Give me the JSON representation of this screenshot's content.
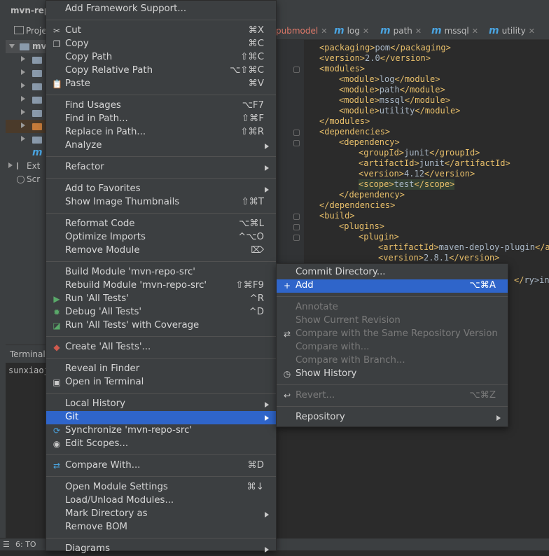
{
  "window": {
    "title": "mvn-repo"
  },
  "project_panel": {
    "label": "Proje",
    "root": "mv",
    "ext": "Ext",
    "scr": "Scr"
  },
  "terminal": {
    "label": "Terminal",
    "prompt": "sunxiaoj"
  },
  "bottom_bar": {
    "label": "6: TO"
  },
  "tabs": [
    {
      "label": "pubmodel",
      "active": true
    },
    {
      "label": "log"
    },
    {
      "label": "path"
    },
    {
      "label": "mssql"
    },
    {
      "label": "utility"
    }
  ],
  "code_lines": [
    {
      "indent": 0,
      "open": "<packaging>",
      "text": "pom",
      "close": "</packaging>"
    },
    {
      "indent": 0,
      "open": "<version>",
      "text": "2.0",
      "close": "</version>"
    },
    {
      "indent": 0,
      "open": "<modules>",
      "text": "",
      "close": ""
    },
    {
      "indent": 1,
      "open": "<module>",
      "text": "log",
      "close": "</module>"
    },
    {
      "indent": 1,
      "open": "<module>",
      "text": "path",
      "close": "</module>"
    },
    {
      "indent": 1,
      "open": "<module>",
      "text": "mssql",
      "close": "</module>"
    },
    {
      "indent": 1,
      "open": "<module>",
      "text": "utility",
      "close": "</module>"
    },
    {
      "indent": 0,
      "open": "</modules>",
      "text": "",
      "close": ""
    },
    {
      "indent": 0,
      "open": "<dependencies>",
      "text": "",
      "close": ""
    },
    {
      "indent": 1,
      "open": "<dependency>",
      "text": "",
      "close": ""
    },
    {
      "indent": 2,
      "open": "<groupId>",
      "text": "junit",
      "close": "</groupId>"
    },
    {
      "indent": 2,
      "open": "<artifactId>",
      "text": "junit",
      "close": "</artifactId>"
    },
    {
      "indent": 2,
      "open": "<version>",
      "text": "4.12",
      "close": "</version>"
    },
    {
      "indent": 2,
      "open": "<scope>",
      "text": "test",
      "close": "</scope>",
      "highlight": true
    },
    {
      "indent": 1,
      "open": "</dependency>",
      "text": "",
      "close": ""
    },
    {
      "indent": 0,
      "open": "</dependencies>",
      "text": "",
      "close": ""
    },
    {
      "indent": 0,
      "open": "<build>",
      "text": "",
      "close": ""
    },
    {
      "indent": 1,
      "open": "<plugins>",
      "text": "",
      "close": ""
    },
    {
      "indent": 2,
      "open": "<plugin>",
      "text": "",
      "close": ""
    },
    {
      "indent": 3,
      "open": "<artifactId>",
      "text": "maven-deploy-plugin",
      "close": "</ar"
    },
    {
      "indent": 3,
      "open": "<version>",
      "text": "2.8.1",
      "close": "</version>"
    }
  ],
  "code_fragment": "ry>intern",
  "context_menu": {
    "sections": [
      [
        {
          "label": "Add Framework Support..."
        }
      ],
      [
        {
          "label": "Cut",
          "shortcut": "⌘X",
          "icon": "cut-icon",
          "glyph": "✂"
        },
        {
          "label": "Copy",
          "shortcut": "⌘C",
          "icon": "copy-icon",
          "glyph": "❐"
        },
        {
          "label": "Copy Path",
          "shortcut": "⇧⌘C"
        },
        {
          "label": "Copy Relative Path",
          "shortcut": "⌥⇧⌘C"
        },
        {
          "label": "Paste",
          "shortcut": "⌘V",
          "icon": "paste-icon",
          "glyph": "📋"
        }
      ],
      [
        {
          "label": "Find Usages",
          "shortcut": "⌥F7"
        },
        {
          "label": "Find in Path...",
          "shortcut": "⇧⌘F"
        },
        {
          "label": "Replace in Path...",
          "shortcut": "⇧⌘R"
        },
        {
          "label": "Analyze",
          "submenu": true
        }
      ],
      [
        {
          "label": "Refactor",
          "submenu": true
        }
      ],
      [
        {
          "label": "Add to Favorites",
          "submenu": true
        },
        {
          "label": "Show Image Thumbnails",
          "shortcut": "⇧⌘T"
        }
      ],
      [
        {
          "label": "Reformat Code",
          "shortcut": "⌥⌘L"
        },
        {
          "label": "Optimize Imports",
          "shortcut": "^⌥O"
        },
        {
          "label": "Remove Module",
          "shortcut": "⌦"
        }
      ],
      [
        {
          "label": "Build Module 'mvn-repo-src'"
        },
        {
          "label": "Rebuild Module 'mvn-repo-src'",
          "shortcut": "⇧⌘F9"
        },
        {
          "label": "Run 'All Tests'",
          "shortcut": "^R",
          "icon": "run-icon",
          "glyph": "▶",
          "color": "#59a869"
        },
        {
          "label": "Debug 'All Tests'",
          "shortcut": "^D",
          "icon": "debug-icon",
          "glyph": "✹",
          "color": "#59a869"
        },
        {
          "label": "Run 'All Tests' with Coverage",
          "icon": "coverage-icon",
          "glyph": "◪",
          "color": "#59a869"
        }
      ],
      [
        {
          "label": "Create 'All Tests'...",
          "icon": "create-test-icon",
          "glyph": "◆",
          "color": "#d05a4e"
        }
      ],
      [
        {
          "label": "Reveal in Finder"
        },
        {
          "label": "Open in Terminal",
          "icon": "terminal-icon",
          "glyph": "▣"
        }
      ],
      [
        {
          "label": "Local History",
          "submenu": true
        },
        {
          "label": "Git",
          "submenu": true,
          "highlighted": true
        },
        {
          "label": "Synchronize 'mvn-repo-src'",
          "icon": "sync-icon",
          "glyph": "⟳",
          "color": "#4aa4e0"
        },
        {
          "label": "Edit Scopes...",
          "icon": "scopes-icon",
          "glyph": "◉"
        }
      ],
      [
        {
          "label": "Compare With...",
          "shortcut": "⌘D",
          "icon": "compare-icon",
          "glyph": "⇄",
          "color": "#4aa4e0"
        }
      ],
      [
        {
          "label": "Open Module Settings",
          "shortcut": "⌘↓"
        },
        {
          "label": "Load/Unload Modules..."
        },
        {
          "label": "Mark Directory as",
          "submenu": true
        },
        {
          "label": "Remove BOM"
        }
      ],
      [
        {
          "label": "Diagrams",
          "submenu": true
        }
      ]
    ]
  },
  "git_submenu": {
    "sections": [
      [
        {
          "label": "Commit Directory..."
        },
        {
          "label": "Add",
          "shortcut": "⌥⌘A",
          "icon": "plus-icon",
          "glyph": "+",
          "highlighted": true
        }
      ],
      [
        {
          "label": "Annotate",
          "disabled": true
        },
        {
          "label": "Show Current Revision",
          "disabled": true
        },
        {
          "label": "Compare with the Same Repository Version",
          "disabled": true,
          "icon": "compare-icon",
          "glyph": "⇄"
        },
        {
          "label": "Compare with...",
          "disabled": true
        },
        {
          "label": "Compare with Branch...",
          "disabled": true
        },
        {
          "label": "Show History",
          "icon": "clock-icon",
          "glyph": "◷"
        }
      ],
      [
        {
          "label": "Revert...",
          "shortcut": "⌥⌘Z",
          "disabled": true,
          "icon": "revert-icon",
          "glyph": "↩"
        }
      ],
      [
        {
          "label": "Repository",
          "submenu": true
        }
      ]
    ]
  }
}
